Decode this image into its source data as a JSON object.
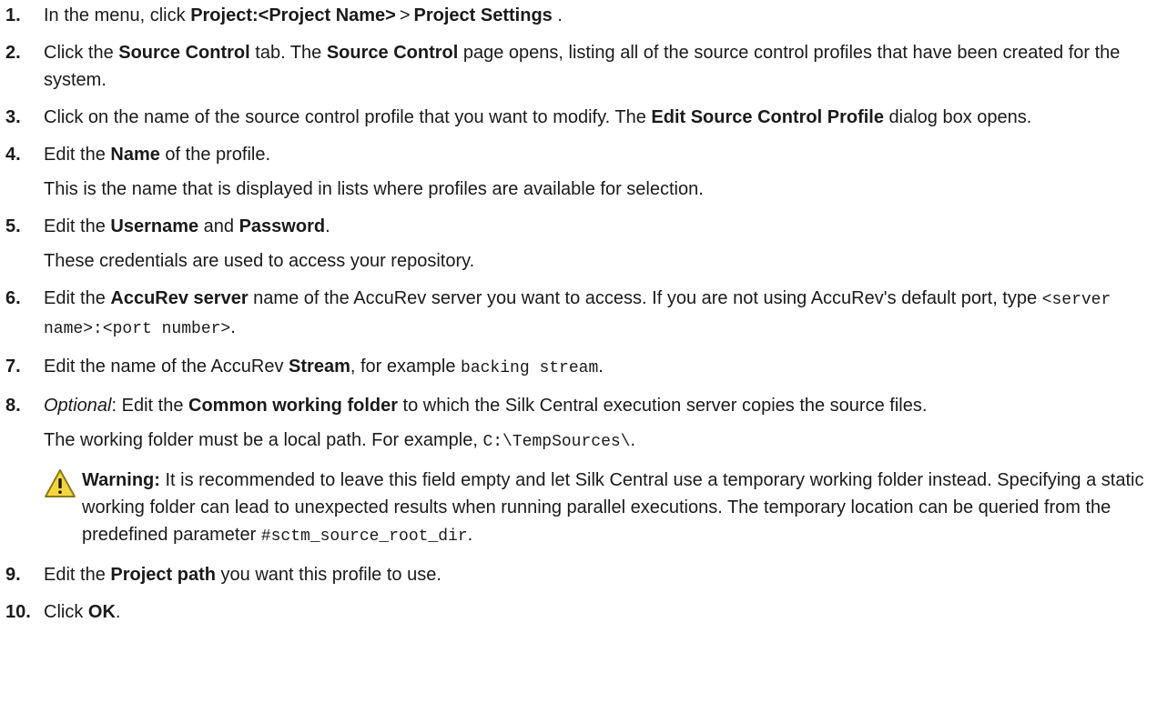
{
  "steps": [
    {
      "num": "1.",
      "text1": "In the menu, click ",
      "b1": "Project:<Project Name>",
      "sep": ">",
      "b2": "Project Settings",
      "text2": "."
    },
    {
      "num": "2.",
      "text1": "Click the ",
      "b1": "Source Control",
      "text2": " tab. The ",
      "b2": "Source Control",
      "text3": " page opens, listing all of the source control profiles that have been created for the system."
    },
    {
      "num": "3.",
      "text1": "Click on the name of the source control profile that you want to modify. The ",
      "b1": "Edit Source Control Profile",
      "text2": " dialog box opens."
    },
    {
      "num": "4.",
      "text1": "Edit the ",
      "b1": "Name",
      "text2": " of the profile.",
      "sub": "This is the name that is displayed in lists where profiles are available for selection."
    },
    {
      "num": "5.",
      "text1": "Edit the ",
      "b1": "Username",
      "text2": " and ",
      "b2": "Password",
      "text3": ".",
      "sub": "These credentials are used to access your repository."
    },
    {
      "num": "6.",
      "text1": "Edit the ",
      "b1": "AccuRev server",
      "text2": " name of the AccuRev server you want to access. If you are not using AccuRev's default port, type ",
      "code1": "<server name>:<port number>",
      "text3": "."
    },
    {
      "num": "7.",
      "text1": "Edit the name of the AccuRev ",
      "b1": "Stream",
      "text2": ", for example ",
      "code1": "backing stream",
      "text3": "."
    },
    {
      "num": "8.",
      "i1": "Optional",
      "text1": ": Edit the ",
      "b1": "Common working folder",
      "text2": " to which the Silk Central execution server copies the source files.",
      "sub1": "The working folder must be a local path. For example, ",
      "sub_code": "C:\\TempSources\\",
      "sub2": "."
    },
    {
      "num": "9.",
      "text1": "Edit the ",
      "b1": "Project path",
      "text2": " you want this profile to use."
    },
    {
      "num": "10.",
      "text1": "Click ",
      "b1": "OK",
      "text2": "."
    }
  ],
  "warning": {
    "icon": "warning-icon",
    "label": "Warning:",
    "text": " It is recommended to leave this field empty and let Silk Central use a temporary working folder instead. Specifying a static working folder can lead to unexpected results when running parallel executions. The temporary location can be queried from the predefined parameter ",
    "code": "#sctm_source_root_dir",
    "end": ".",
    "colors": {
      "fill": "#f5d63d",
      "stroke": "#8a7a1a",
      "mark": "#1a1a1a"
    }
  }
}
